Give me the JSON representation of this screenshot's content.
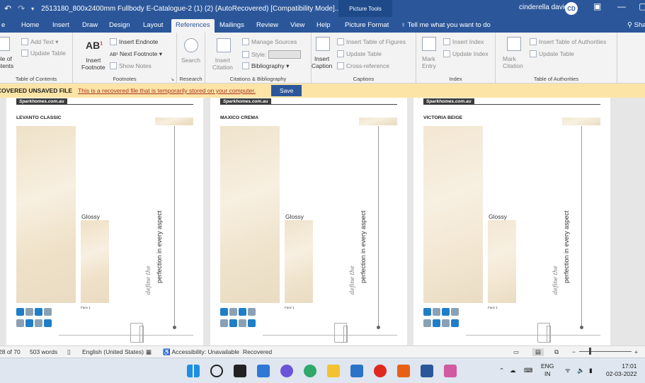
{
  "titlebar": {
    "doc_title": "2513180_800x2400mm Fullbody E-Catalogue-2 (1) (2) (AutoRecovered) [Compatibility Mode]...",
    "context_tool": "Picture Tools",
    "user": "cinderella david",
    "avatar_initials": "CD"
  },
  "tabs": [
    "e",
    "Home",
    "Insert",
    "Draw",
    "Design",
    "Layout",
    "References",
    "Mailings",
    "Review",
    "View",
    "Help",
    "Picture Format"
  ],
  "active_tab": "References",
  "tell_me": "Tell me what you want to do",
  "share": "Sha",
  "ribbon": {
    "toc": {
      "big": "ble of\nntents",
      "add_text": "Add Text",
      "update_table": "Update Table",
      "label": "Table of Contents"
    },
    "footnotes": {
      "big": "Insert\nFootnote",
      "insert_endnote": "Insert Endnote",
      "next_footnote": "Next Footnote",
      "show_notes": "Show Notes",
      "label": "Footnotes"
    },
    "research": {
      "big": "Search",
      "label": "Research"
    },
    "citations": {
      "big": "Insert\nCitation",
      "manage_sources": "Manage Sources",
      "style": "Style:",
      "bibliography": "Bibliography",
      "label": "Citations & Bibliography"
    },
    "captions": {
      "big": "Insert\nCaption",
      "insert_tof": "Insert Table of Figures",
      "update_table": "Update Table",
      "cross_ref": "Cross-reference",
      "label": "Captions"
    },
    "index": {
      "big": "Mark\nEntry",
      "insert_index": "Insert Index",
      "update_index": "Update Index",
      "label": "Index"
    },
    "toa": {
      "big": "Mark\nCitation",
      "insert_toa": "Insert Table of Authorities",
      "update_table": "Update Table",
      "label": "Table of Authorities"
    }
  },
  "recovered": {
    "title": "COVERED UNSAVED FILE",
    "message": "This is a recovered file that is temporarily stored on your computer.",
    "save": "Save"
  },
  "pages": [
    {
      "brand": "Sparkhomes.com.au",
      "title": "LEVANTO CLASSIC",
      "finish": "Glossy",
      "face": "Face 1",
      "slogan": "perfection in every aspect",
      "script": "define the",
      "tile_color": "#efe1c7"
    },
    {
      "brand": "Sparkhomes.com.au",
      "title": "MAXICO CREMA",
      "finish": "Glossy",
      "face": "Face 1",
      "slogan": "perfection in every aspect",
      "script": "define the",
      "tile_color": "#efe3cc"
    },
    {
      "brand": "Sparkhomes.com.au",
      "title": "VICTORIA BEIGE",
      "finish": "Glossy",
      "face": "Face 1",
      "slogan": "perfection in every aspect",
      "script": "define the",
      "tile_color": "#f3e7d3"
    }
  ],
  "status": {
    "page": "28 of 70",
    "words": "503 words",
    "language": "English (United States)",
    "accessibility": "Accessibility: Unavailable",
    "recovered": "Recovered"
  },
  "taskbar": {
    "lang_top": "ENG",
    "lang_bottom": "IN",
    "time": "17:01",
    "date": "02-03-2022"
  },
  "colors": {
    "word_blue": "#2b579a",
    "banner": "#fce4a6",
    "icon_blue": "#1f7ec8"
  }
}
